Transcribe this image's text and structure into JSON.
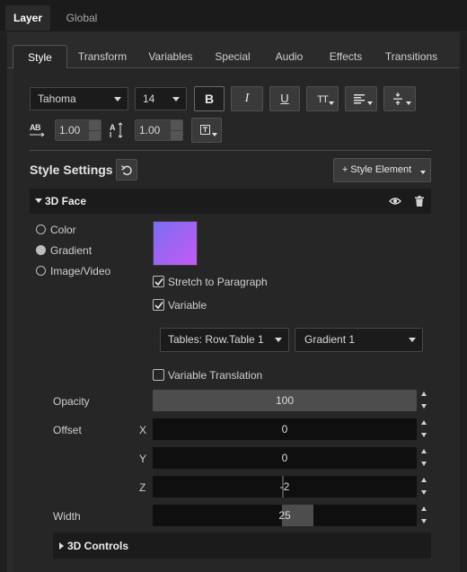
{
  "top_tabs": [
    {
      "label": "Layer",
      "active": true
    },
    {
      "label": "Global",
      "active": false
    }
  ],
  "sub_tabs": [
    {
      "label": "Style",
      "active": true
    },
    {
      "label": "Transform"
    },
    {
      "label": "Variables"
    },
    {
      "label": "Special"
    },
    {
      "label": "Audio"
    },
    {
      "label": "Effects"
    },
    {
      "label": "Transitions"
    }
  ],
  "toolbar": {
    "font_family": "Tahoma",
    "font_size": "14",
    "bold_label": "B",
    "italic_label": "I",
    "underline_label": "U",
    "text_size_label": "TT",
    "kerning_value": "1.00",
    "leading_value": "1.00",
    "kerning_icon_label": "AB"
  },
  "style_settings": {
    "title": "Style Settings",
    "add_button": "+ Style Element"
  },
  "face_section": {
    "title": "3D Face",
    "fill_options": [
      {
        "label": "Color",
        "selected": false
      },
      {
        "label": "Gradient",
        "selected": true
      },
      {
        "label": "Image/Video",
        "selected": false
      }
    ],
    "swatch_gradient_from": "#7c6cf0",
    "swatch_gradient_to": "#c35cf5",
    "stretch_label": "Stretch to Paragraph",
    "stretch_checked": true,
    "variable_label": "Variable",
    "variable_checked": true,
    "table_dropdown": "Tables: Row.Table 1",
    "gradient_dropdown": "Gradient 1",
    "variable_translation_label": "Variable Translation",
    "variable_translation_checked": false,
    "opacity_label": "Opacity",
    "opacity_value": "100",
    "opacity_fraction": 1.0,
    "offset_label": "Offset",
    "offset_x_label": "X",
    "offset_x": "0",
    "offset_y_label": "Y",
    "offset_y": "0",
    "offset_z_label": "Z",
    "offset_z": "-2",
    "width_label": "Width",
    "width_value": "25",
    "width_fraction": 0.32
  },
  "controls_section": {
    "title": "3D Controls"
  }
}
